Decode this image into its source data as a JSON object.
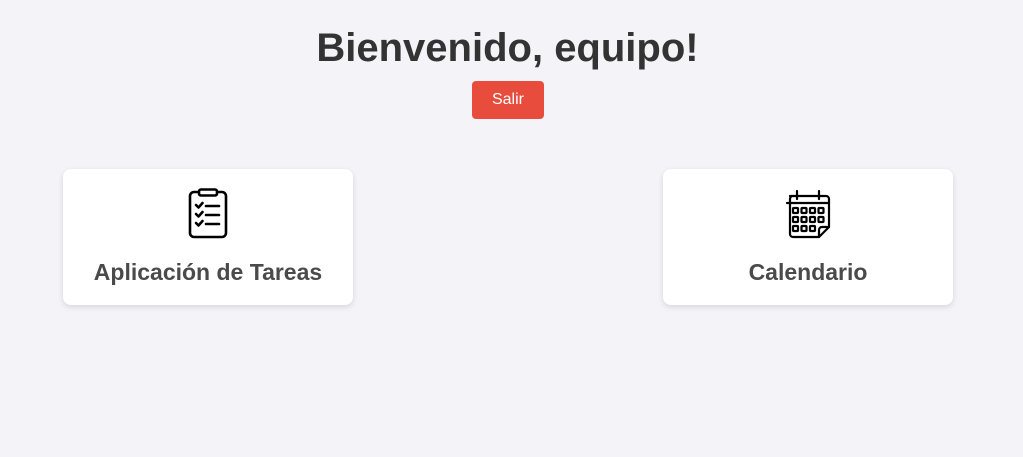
{
  "header": {
    "title": "Bienvenido, equipo!",
    "logout_label": "Salir"
  },
  "cards": [
    {
      "label": "Aplicación de Tareas",
      "icon": "clipboard-checklist-icon"
    },
    {
      "label": "Calendario",
      "icon": "calendar-icon"
    }
  ],
  "colors": {
    "background": "#f4f3f8",
    "logout_button": "#e74c3c",
    "title_text": "#333333",
    "card_text": "#4a4a4a",
    "card_background": "#ffffff"
  }
}
